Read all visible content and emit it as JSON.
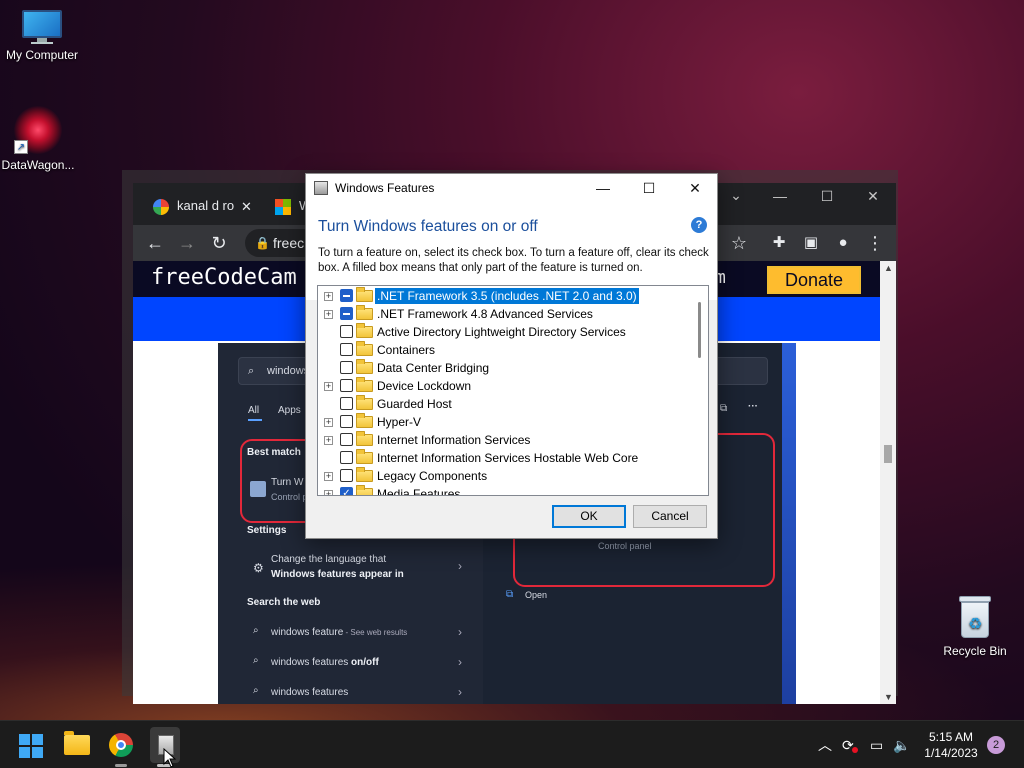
{
  "desktop": {
    "icons": [
      {
        "label": "My Computer"
      },
      {
        "label": "DataWagon..."
      },
      {
        "label": "Recycle Bin"
      }
    ]
  },
  "browser": {
    "tabs": [
      {
        "title": "kanal d ro"
      },
      {
        "title": "W"
      }
    ],
    "address": "freec",
    "site": {
      "logo": "freeCodeCam",
      "logo_tail": "m",
      "donate": "Donate"
    },
    "screenshot": {
      "search_text": "windows",
      "filter_all": "All",
      "filter_apps": "Apps",
      "best_match": "Best match",
      "best_item_title": "Turn W",
      "best_item_sub": "Control p",
      "settings_header": "Settings",
      "settings_item_line1": "Change the language that",
      "settings_item_line2": "Windows features appear in",
      "web_header": "Search the web",
      "web_items": [
        {
          "bold": "windows feature",
          "rest": " - See web results"
        },
        {
          "bold": "windows features on/off",
          "rest": ""
        },
        {
          "bold": "windows features",
          "rest": ""
        }
      ],
      "right_control_panel": "Control panel",
      "right_open": "Open"
    }
  },
  "dialog": {
    "title": "Windows Features",
    "heading": "Turn Windows features on or off",
    "help_glyph": "?",
    "description": "To turn a feature on, select its check box. To turn a feature off, clear its check box. A filled box means that only part of the feature is turned on.",
    "features": [
      {
        "label": ".NET Framework 3.5 (includes .NET 2.0 and 3.0)",
        "expandable": true,
        "state": "partial",
        "selected": true
      },
      {
        "label": ".NET Framework 4.8 Advanced Services",
        "expandable": true,
        "state": "partial",
        "selected": false
      },
      {
        "label": "Active Directory Lightweight Directory Services",
        "expandable": false,
        "state": "unchecked",
        "selected": false
      },
      {
        "label": "Containers",
        "expandable": false,
        "state": "unchecked",
        "selected": false
      },
      {
        "label": "Data Center Bridging",
        "expandable": false,
        "state": "unchecked",
        "selected": false
      },
      {
        "label": "Device Lockdown",
        "expandable": true,
        "state": "unchecked",
        "selected": false
      },
      {
        "label": "Guarded Host",
        "expandable": false,
        "state": "unchecked",
        "selected": false
      },
      {
        "label": "Hyper-V",
        "expandable": true,
        "state": "unchecked",
        "selected": false
      },
      {
        "label": "Internet Information Services",
        "expandable": true,
        "state": "unchecked",
        "selected": false
      },
      {
        "label": "Internet Information Services Hostable Web Core",
        "expandable": false,
        "state": "unchecked",
        "selected": false
      },
      {
        "label": "Legacy Components",
        "expandable": true,
        "state": "unchecked",
        "selected": false
      },
      {
        "label": "Media Features",
        "expandable": true,
        "state": "checked",
        "selected": false
      }
    ],
    "ok_label": "OK",
    "cancel_label": "Cancel"
  },
  "taskbar": {
    "time": "5:15 AM",
    "date": "1/14/2023",
    "notification_count": "2"
  },
  "colors": {
    "dialog_heading": "#1b4f9c",
    "selection": "#0078d7",
    "donate": "#febc2e",
    "fcc_navy": "#0a0a23",
    "fcc_blue": "#0045ff",
    "highlight_red": "#e2283a"
  }
}
